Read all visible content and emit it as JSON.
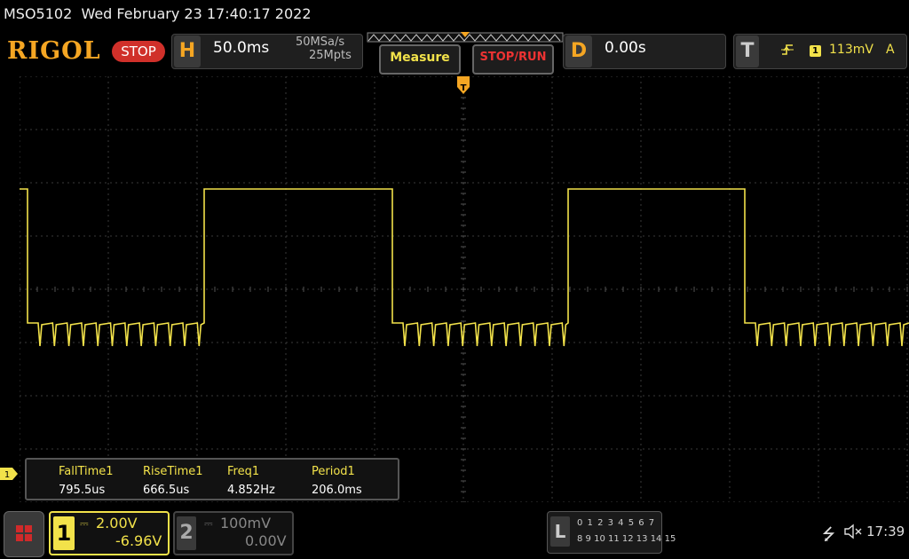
{
  "status": {
    "model": "MSO5102",
    "datetime": "Wed February 23 17:40:17 2022"
  },
  "topbar": {
    "logo": "RIGOL",
    "run_state": "STOP",
    "horizontal": {
      "letter": "H",
      "timebase": "50.0ms",
      "sample_rate": "50MSa/s",
      "memory_depth": "25Mpts"
    },
    "measure_label": "Measure",
    "stoprun_label": "STOP/RUN",
    "delay": {
      "letter": "D",
      "value": "0.00s"
    },
    "trigger": {
      "letter": "T",
      "channel": "1",
      "level": "113mV",
      "mode": "A"
    }
  },
  "measurements": [
    {
      "label": "FallTime1",
      "value": "795.5us"
    },
    {
      "label": "RiseTime1",
      "value": "666.5us"
    },
    {
      "label": "Freq1",
      "value": "4.852Hz"
    },
    {
      "label": "Period1",
      "value": "206.0ms"
    }
  ],
  "channel_marker": "1",
  "channels": {
    "ch1": {
      "number": "1",
      "scale": "2.00V",
      "offset": "-6.96V"
    },
    "ch2": {
      "number": "2",
      "scale": "100mV",
      "offset": "0.00V"
    }
  },
  "logic": {
    "letter": "L",
    "row1": "0 1 2 3  4 5 6 7",
    "row2": "8 9 10 11 12 13 14 15"
  },
  "system": {
    "time": "17:39"
  },
  "colors": {
    "ch1": "#f2e24a",
    "accent": "#f5a623",
    "stop": "#d0302a"
  }
}
